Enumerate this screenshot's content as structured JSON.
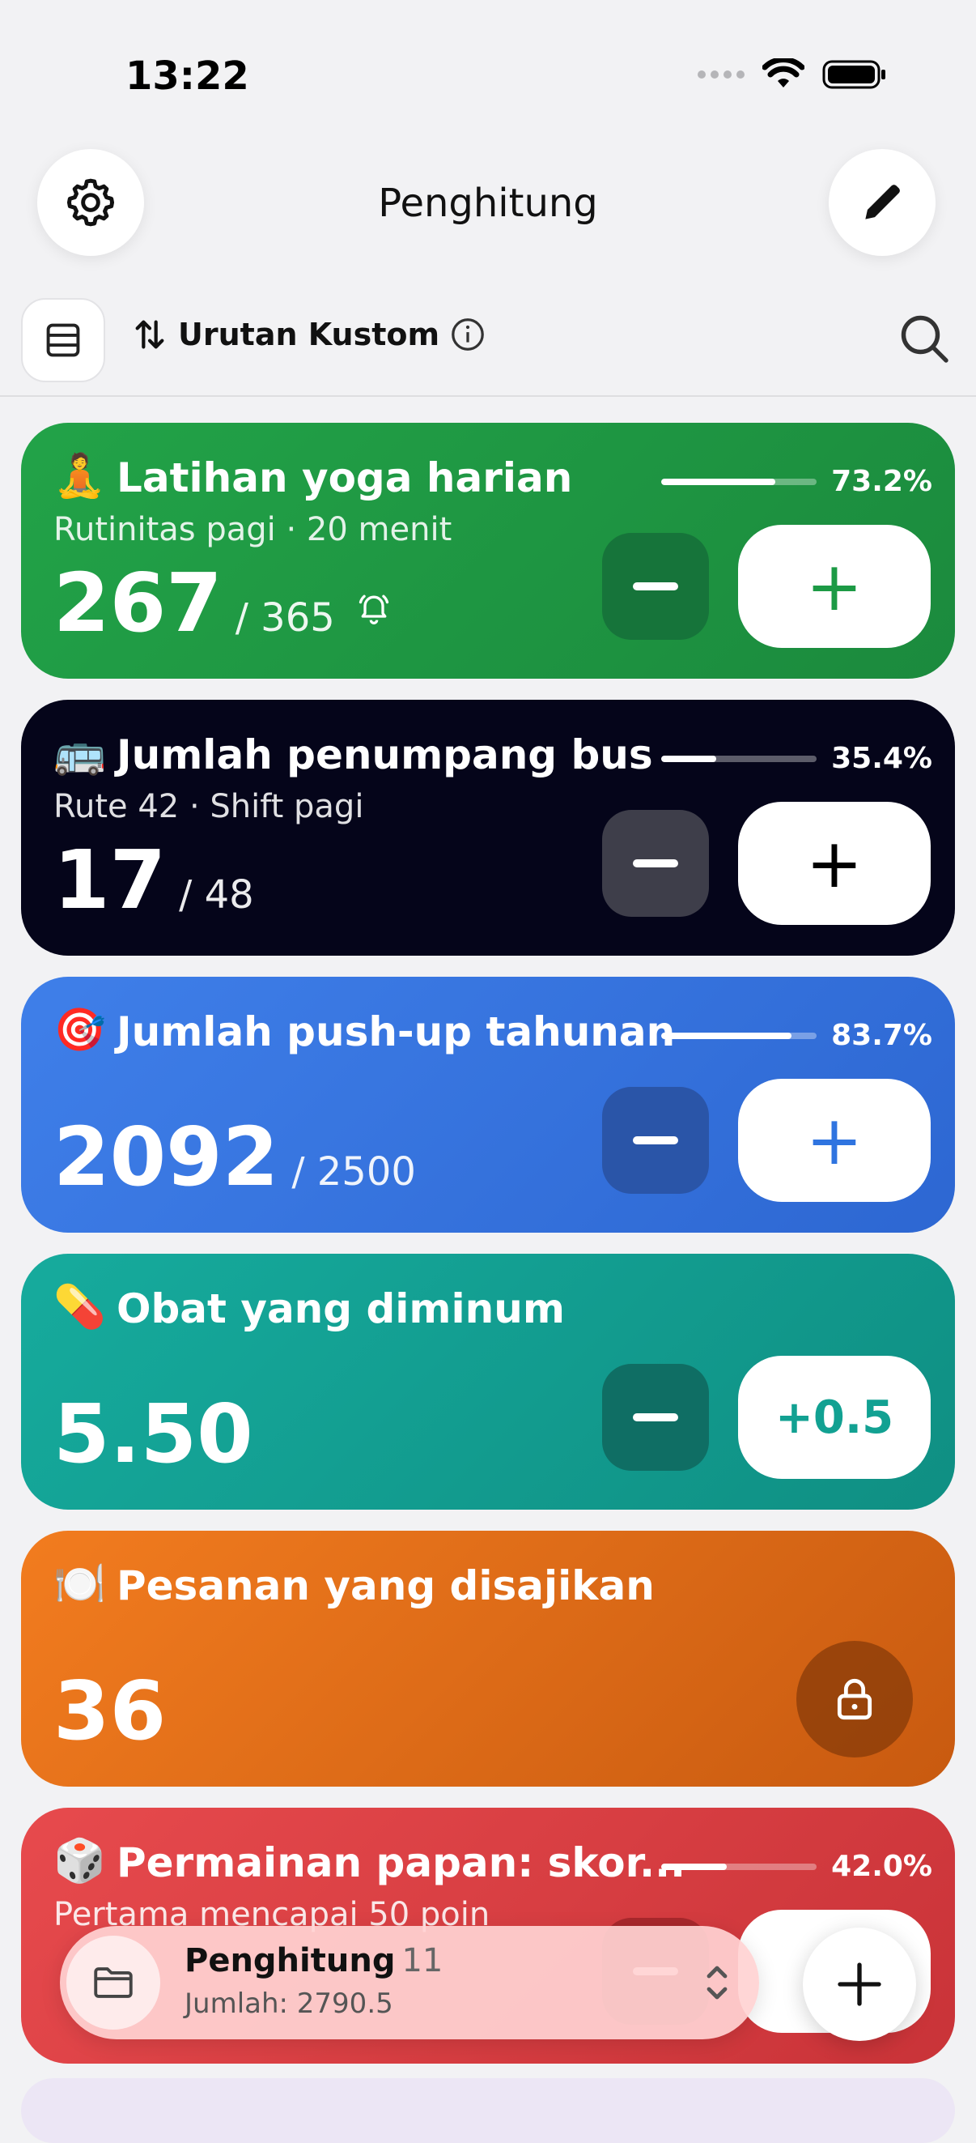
{
  "status_bar": {
    "time": "13:22"
  },
  "header": {
    "title": "Penghitung",
    "settings_icon": "gear-icon",
    "edit_icon": "pencil-icon"
  },
  "toolbar": {
    "sort_label": "Urutan Kustom",
    "sort_icon": "sort-arrows-icon",
    "info_icon": "info-icon",
    "search_icon": "search-icon"
  },
  "cards": [
    {
      "emoji": "🧘",
      "title": "Latihan yoga harian",
      "subtitle": "Rutinitas pagi · 20 menit",
      "count": "267",
      "target": "/ 365",
      "progress_label": "73.2%",
      "progress": 0.732,
      "plus_label": "+",
      "has_reminder": true,
      "color": "#23a047",
      "accent": "#1c9a45"
    },
    {
      "emoji": "🚌",
      "title": "Jumlah penumpang bus",
      "subtitle": "Rute 42 · Shift pagi",
      "count": "17",
      "target": "/ 48",
      "progress_label": "35.4%",
      "progress": 0.354,
      "plus_label": "+",
      "color": "#05051a",
      "accent": "#000000"
    },
    {
      "emoji": "🎯",
      "title": "Jumlah push-up tahunan",
      "subtitle": "",
      "count": "2092",
      "target": "/ 2500",
      "progress_label": "83.7%",
      "progress": 0.837,
      "plus_label": "+",
      "color": "#3b78e7",
      "accent": "#2f74e0"
    },
    {
      "emoji": "💊",
      "title": "Obat yang diminum",
      "subtitle": "",
      "count": "5.50",
      "target": "",
      "plus_label": "+0.5",
      "color": "#149e92",
      "accent": "#12a192"
    },
    {
      "emoji": "🍽️",
      "title": "Pesanan yang disajikan",
      "subtitle": "",
      "count": "36",
      "target": "",
      "locked": true,
      "color": "#ee7a1c"
    },
    {
      "emoji": "🎲",
      "title": "Permainan papan: skor...",
      "subtitle": "Pertama mencapai 50 poin",
      "count": "",
      "target": "",
      "progress_label": "42.0%",
      "progress": 0.42,
      "color": "#e2484c"
    }
  ],
  "bottom_bar": {
    "title": "Penghitung",
    "count": "11",
    "subtitle": "Jumlah: 2790.5",
    "folder_icon": "folder-icon",
    "chevron_icon": "chevron-up-down-icon",
    "add_icon": "plus-icon"
  }
}
